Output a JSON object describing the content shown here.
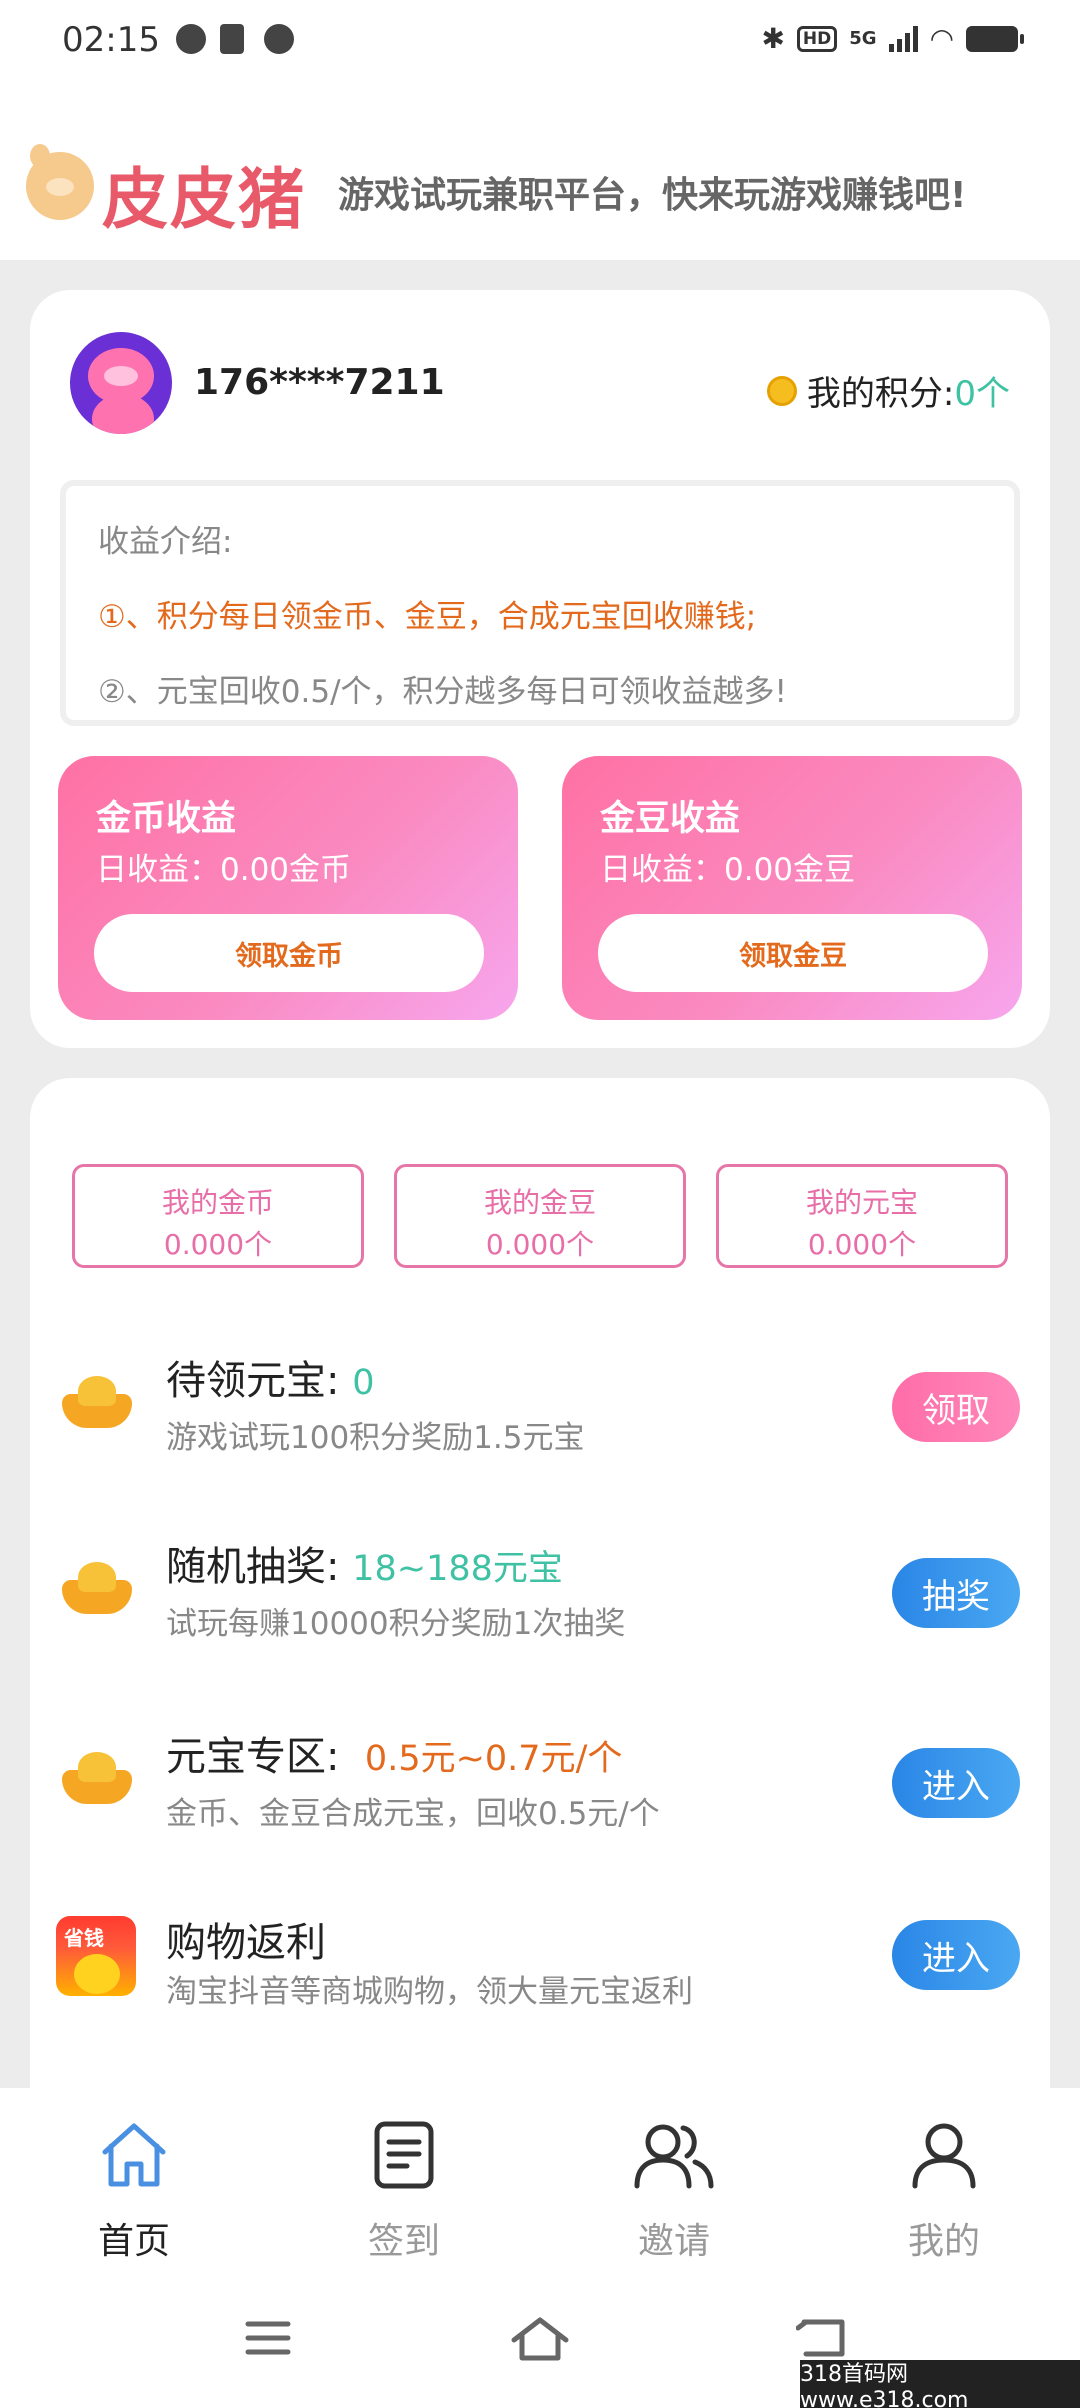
{
  "status": {
    "time": "02:15",
    "hd": "HD",
    "net": "5G"
  },
  "header": {
    "brand": "皮皮猪",
    "slogan": "游戏试玩兼职平台，快来玩游戏赚钱吧!"
  },
  "user": {
    "phone": "176****7211",
    "points_label": "我的积分:",
    "points_value": "0个"
  },
  "intro": {
    "title": "收益介绍:",
    "line1": "①、积分每日领金币、金豆，合成元宝回收赚钱;",
    "line2": "②、元宝回收0.5/个，积分越多每日可领收益越多!"
  },
  "earnings": [
    {
      "title": "金币收益",
      "daily": "日收益：0.00金币",
      "button": "领取金币"
    },
    {
      "title": "金豆收益",
      "daily": "日收益：0.00金豆",
      "button": "领取金豆"
    }
  ],
  "balances": [
    {
      "label": "我的金币",
      "value": "0.000个"
    },
    {
      "label": "我的金豆",
      "value": "0.000个"
    },
    {
      "label": "我的元宝",
      "value": "0.000个"
    }
  ],
  "rows": [
    {
      "title": "待领元宝:",
      "value": "0",
      "value_color": "#3fc1a4",
      "desc": "游戏试玩100积分奖励1.5元宝",
      "button": "领取"
    },
    {
      "title": "随机抽奖:",
      "value": "18~188元宝",
      "value_color": "#3fc1a4",
      "desc": "试玩每赚10000积分奖励1次抽奖",
      "button": "抽奖"
    },
    {
      "title": "元宝专区:",
      "value": "0.5元~0.7元/个",
      "value_color": "#e36a1d",
      "desc": "金币、金豆合成元宝，回收0.5元/个",
      "button": "进入"
    },
    {
      "title": "购物返利",
      "value": "",
      "desc": "淘宝抖音等商城购物，领大量元宝返利",
      "button": "进入",
      "icon_text": "省钱"
    }
  ],
  "tabs": [
    {
      "label": "首页",
      "icon": "home-icon"
    },
    {
      "label": "签到",
      "icon": "checkin-icon"
    },
    {
      "label": "邀请",
      "icon": "invite-icon"
    },
    {
      "label": "我的",
      "icon": "profile-icon"
    }
  ],
  "watermark": "318首码网 www.e318.com",
  "colors": {
    "accent_pink": "#ff6da8",
    "accent_blue": "#2a86e6",
    "brand_red": "#e85a6a",
    "green": "#3fc1a4",
    "orange": "#e36a1d"
  }
}
